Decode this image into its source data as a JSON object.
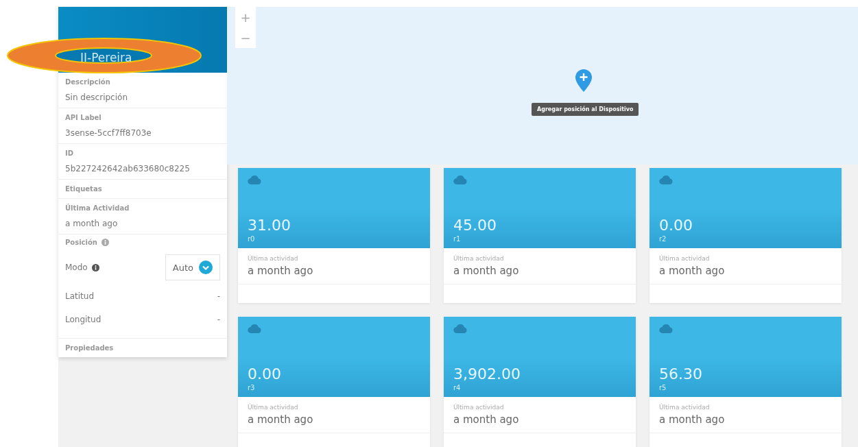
{
  "device": {
    "name": "II-Pereira"
  },
  "details": [
    {
      "label": "Descripción",
      "value": "Sin descripción"
    },
    {
      "label": "API Label",
      "value": "3sense-5ccf7ff8703e"
    },
    {
      "label": "ID",
      "value": "5b227242642ab633680c8225"
    },
    {
      "label": "Etiquetas"
    },
    {
      "label": "Última Actividad",
      "value": "a month ago"
    }
  ],
  "position": {
    "label": "Posición",
    "mode_label": "Modo",
    "mode_value": "Auto",
    "coords": [
      {
        "label": "Latitud",
        "value": "-"
      },
      {
        "label": "Longitud",
        "value": "-"
      }
    ]
  },
  "properties_label": "Propiedades",
  "map": {
    "zoom_in": "+",
    "zoom_out": "−",
    "tooltip": "Agregar posición al Dispositivo"
  },
  "variables": [
    {
      "value": "31.00",
      "name": "r0",
      "activity_label": "Última actividad",
      "activity": "a month ago"
    },
    {
      "value": "45.00",
      "name": "r1",
      "activity_label": "Última actividad",
      "activity": "a month ago"
    },
    {
      "value": "0.00",
      "name": "r2",
      "activity_label": "Última actividad",
      "activity": "a month ago"
    },
    {
      "value": "0.00",
      "name": "r3",
      "activity_label": "Última actividad",
      "activity": "a month ago"
    },
    {
      "value": "3,902.00",
      "name": "r4",
      "activity_label": "Última actividad",
      "activity": "a month ago"
    },
    {
      "value": "56.30",
      "name": "r5",
      "activity_label": "Última actividad",
      "activity": "a month ago"
    }
  ]
}
